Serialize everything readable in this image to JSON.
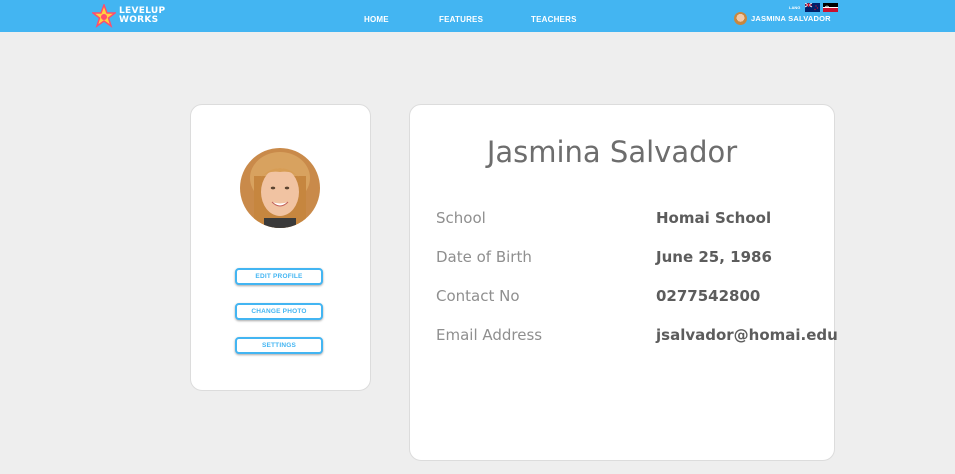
{
  "header": {
    "logo_line1": "LEVELUP",
    "logo_line2": "WORKS",
    "nav": [
      "HOME",
      "FEATURES",
      "TEACHERS"
    ],
    "lang_label": "LANG",
    "user_name": "JASMINA SALVADOR",
    "colors": {
      "bar": "#43b5f2"
    }
  },
  "sidebar": {
    "buttons": {
      "edit_profile": "EDIT PROFILE",
      "change_photo": "CHANGE PHOTO",
      "settings": "SETTINGS"
    }
  },
  "profile": {
    "full_name": "Jasmina Salvador",
    "fields": [
      {
        "label": "School",
        "value": "Homai School"
      },
      {
        "label": "Date of Birth",
        "value": "June 25, 1986"
      },
      {
        "label": "Contact No",
        "value": "0277542800"
      },
      {
        "label": "Email Address",
        "value": "jsalvador@homai.edu"
      }
    ]
  }
}
